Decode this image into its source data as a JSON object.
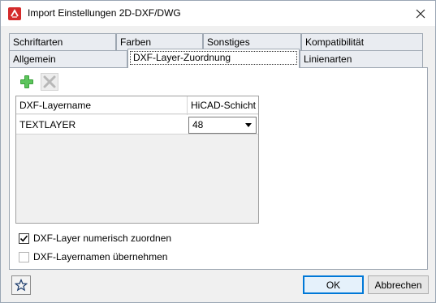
{
  "window": {
    "title": "Import Einstellungen 2D-DXF/DWG"
  },
  "tabs": {
    "row1": [
      {
        "label": "Schriftarten"
      },
      {
        "label": "Farben"
      },
      {
        "label": "Sonstiges"
      },
      {
        "label": "Kompatibilität"
      }
    ],
    "row2": [
      {
        "label": "Allgemein"
      },
      {
        "label": "DXF-Layer-Zuordnung"
      },
      {
        "label": "Linienarten"
      }
    ],
    "active": "DXF-Layer-Zuordnung"
  },
  "toolbar": {
    "add_icon": "plus-icon",
    "delete_icon": "delete-x-icon"
  },
  "grid": {
    "columns": [
      "DXF-Layername",
      "HiCAD-Schicht"
    ],
    "rows": [
      {
        "layername": "TEXTLAYER",
        "schicht": "48"
      }
    ]
  },
  "options": {
    "numeric": {
      "label": "DXF-Layer numerisch zuordnen",
      "checked": true
    },
    "names": {
      "label": "DXF-Layernamen übernehmen",
      "checked": false
    }
  },
  "footer": {
    "fav_icon": "star-icon",
    "ok_label": "OK",
    "cancel_label": "Abbrechen"
  },
  "colors": {
    "accent": "#0078d7",
    "add_green": "#3aa13a"
  }
}
